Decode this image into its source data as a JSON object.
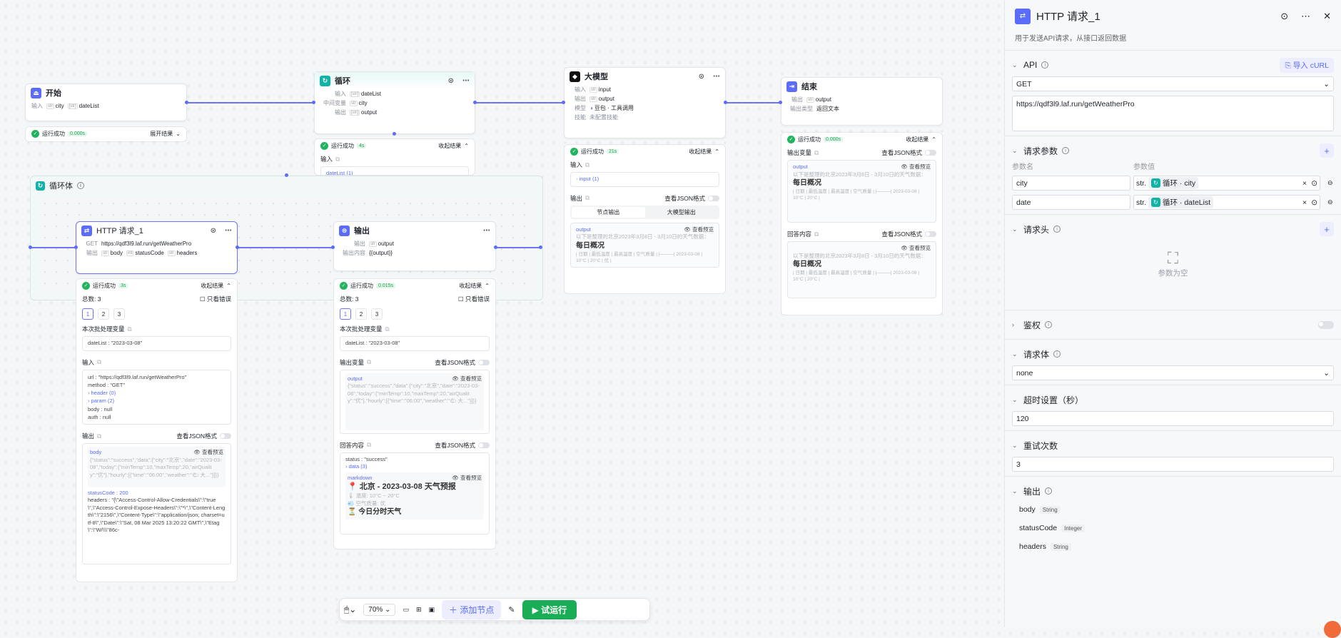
{
  "nodes": {
    "start": {
      "title": "开始",
      "in_label": "输入",
      "vars": [
        "city",
        "dateList"
      ],
      "run": "运行成功",
      "time": "0.000s",
      "expand": "展开结果"
    },
    "loop": {
      "title": "循环",
      "rows": [
        {
          "k": "输入",
          "v": "dateList"
        },
        {
          "k": "中间变量",
          "v": "city"
        },
        {
          "k": "输出",
          "v": "output"
        }
      ],
      "run": "运行成功",
      "time": "4s",
      "collapse": "收起结果",
      "input_label": "输入",
      "partial": "dateList (1)"
    },
    "loop_body": {
      "title": "循环体"
    },
    "llm": {
      "title": "大模型",
      "rows": [
        {
          "k": "输入",
          "v": "input"
        },
        {
          "k": "输出",
          "v": "output"
        }
      ],
      "model_k": "模型",
      "model_v": "豆包 · 工具调用",
      "skill_k": "技能",
      "skill_v": "未配置技能",
      "run": "运行成功",
      "time": "21s",
      "collapse": "收起结果",
      "input_label": "输入",
      "input_val": "input (1)",
      "output_label": "输出",
      "json_toggle": "查看JSON格式",
      "tab1": "节点输出",
      "tab2": "大模型输出",
      "out_name": "output",
      "preview": "查看预览",
      "out_text": "以下是整理的北京2023年3月8日 - 3月10日的天气数据：",
      "out_h": "每日概况",
      "out_table": "| 日期 | 最低温度 | 最高温度 | 空气质量 | |———| 2023-03-08 | 10°C | 20°C | 优 |"
    },
    "end": {
      "title": "结束",
      "out_k": "输出",
      "out_v": "output",
      "type_k": "输出类型",
      "type_v": "返回文本",
      "run": "运行成功",
      "time": "0.000s",
      "collapse": "收起结果",
      "outvar": "输出变量",
      "json_toggle": "查看JSON格式",
      "out_name": "output",
      "preview": "查看预览",
      "out_text": "以下是整理的北京2023年3月8日 - 3月10日的天气数据：",
      "out_h": "每日概况",
      "out_table": "| 日期 | 最低温度 | 最高温度 | 空气质量 | |———| 2023-03-08 | 10°C | 20°C |",
      "answer": "回答内容"
    },
    "http": {
      "title": "HTTP 请求_1",
      "method": "GET",
      "url": "https://qdf3l9.laf.run/getWeatherPro",
      "out_k": "输出",
      "outs": [
        "body",
        "statusCode",
        "headers"
      ],
      "run": "运行成功",
      "time": "3s",
      "collapse": "收起结果",
      "total": "总数: 3",
      "only_err": "只看错误",
      "pages": [
        "1",
        "2",
        "3"
      ],
      "batch": "本次批处理变量",
      "batch_val": "dateList : \"2023-03-08\"",
      "input_label": "输入",
      "in_lines": [
        "url : \"https://qdf3l9.laf.run/getWeatherPro\"",
        "method : \"GET\"",
        "header (0)",
        "param (2)",
        "body : null",
        "auth : null"
      ],
      "output_label": "输出",
      "json_toggle": "查看JSON格式",
      "body_name": "body",
      "preview": "查看预览",
      "body_text": "{\"status\":\"success\",\"data\":{\"city\":\"北京\",\"date\":\"2023-03-08\",\"today\":{\"minTemp\":10,\"maxTemp\":20,\"airQuality\":\"优\"},\"hourly\":[{\"time\":\"06:00\",\"weather\":\"🌤 大...\"}]}}",
      "status_line": "statusCode : 200",
      "headers_line": "headers : \"{\\\"Access-Control-Allow-Credentials\\\":\\\"true\\\",\\\"Access-Control-Expose-Headers\\\":\\\"*\\\",\\\"Content-Length\\\":\\\"2156\\\",\\\"Content-Type\\\":\\\"application/json; charset=utf-8\\\",\\\"Date\\\":\\\"Sat, 08 Mar 2025 13:20:22 GMT\\\",\\\"Etag\\\":\\\"W/\\\\\\\"86c-"
    },
    "out": {
      "title": "输出",
      "out_k": "输出",
      "out_v": "output",
      "content_k": "输出内容",
      "content_v": "{{output}}",
      "run": "运行成功",
      "time": "0.015s",
      "collapse": "收起结果",
      "total": "总数: 3",
      "only_err": "只看错误",
      "pages": [
        "1",
        "2",
        "3"
      ],
      "batch": "本次批处理变量",
      "batch_val": "dateList : \"2023-03-08\"",
      "outvar": "输出变量",
      "json_toggle": "查看JSON格式",
      "out_name": "output",
      "preview": "查看预览",
      "out_text": "{\"status\":\"success\",\"data\":{\"city\":\"北京\",\"date\":\"2023-03-08\",\"today\":{\"minTemp\":10,\"maxTemp\":20,\"airQuality\":\"优\"},\"hourly\":[{\"time\":\"06:00\",\"weather\":\"🌤 大...\"}]}}",
      "answer": "回答内容",
      "status_line": "status : \"success\"",
      "data_line": "data (3)",
      "md_name": "markdown",
      "md_h": "📍 北京 - 2023-03-08 天气预报",
      "md_l1": "🌡 温度: 10°C ~ 20°C",
      "md_l2": "💨 空气质量: 优",
      "md_l3": "⏳ 今日分时天气"
    }
  },
  "panel": {
    "title": "HTTP 请求_1",
    "subtitle": "用于发送API请求，从接口返回数据",
    "api_label": "API",
    "import_curl": "导入 cURL",
    "method": "GET",
    "url": "https://qdf3l9.laf.run/getWeatherPro",
    "params_label": "请求参数",
    "col_name": "参数名",
    "col_value": "参数值",
    "params": [
      {
        "name": "city",
        "type": "str.",
        "ref": "循环 · city"
      },
      {
        "name": "date",
        "type": "str.",
        "ref": "循环 · dateList"
      }
    ],
    "headers_label": "请求头",
    "empty": "参数为空",
    "auth_label": "鉴权",
    "body_label": "请求体",
    "body_val": "none",
    "timeout_label": "超时设置（秒）",
    "timeout_val": "120",
    "retry_label": "重试次数",
    "retry_val": "3",
    "output_label": "输出",
    "outputs": [
      {
        "name": "body",
        "type": "String"
      },
      {
        "name": "statusCode",
        "type": "Integer"
      },
      {
        "name": "headers",
        "type": "String"
      }
    ]
  },
  "toolbar": {
    "zoom": "70%",
    "add_node": "添加节点",
    "run": "试运行"
  }
}
